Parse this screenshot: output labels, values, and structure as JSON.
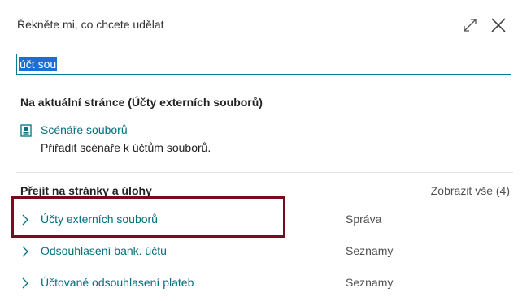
{
  "header": {
    "title": "Řekněte mi, co chcete udělat",
    "expand_icon": "expand-icon",
    "close_icon": "close-icon"
  },
  "search": {
    "value": "účt sou"
  },
  "current_page": {
    "title": "Na aktuální stránce (Účty externích souborů)",
    "items": [
      {
        "icon": "file-scenario-icon",
        "label": "Scénáře souborů",
        "description": "Přiřadit scénáře k účtům souborů."
      }
    ]
  },
  "pages_tasks": {
    "title": "Přejít na stránky a úlohy",
    "show_all": "Zobrazit vše (4)",
    "items": [
      {
        "label": "Účty externích souborů",
        "category": "Správa"
      },
      {
        "label": "Odsouhlasení bank. účtu",
        "category": "Seznamy"
      },
      {
        "label": "Účtované odsouhlasení plateb",
        "category": "Seznamy"
      }
    ]
  },
  "colors": {
    "link": "#00707c",
    "accent_border": "#00808c",
    "highlight": "#7a0b1f",
    "selection": "#1a6ed8"
  }
}
